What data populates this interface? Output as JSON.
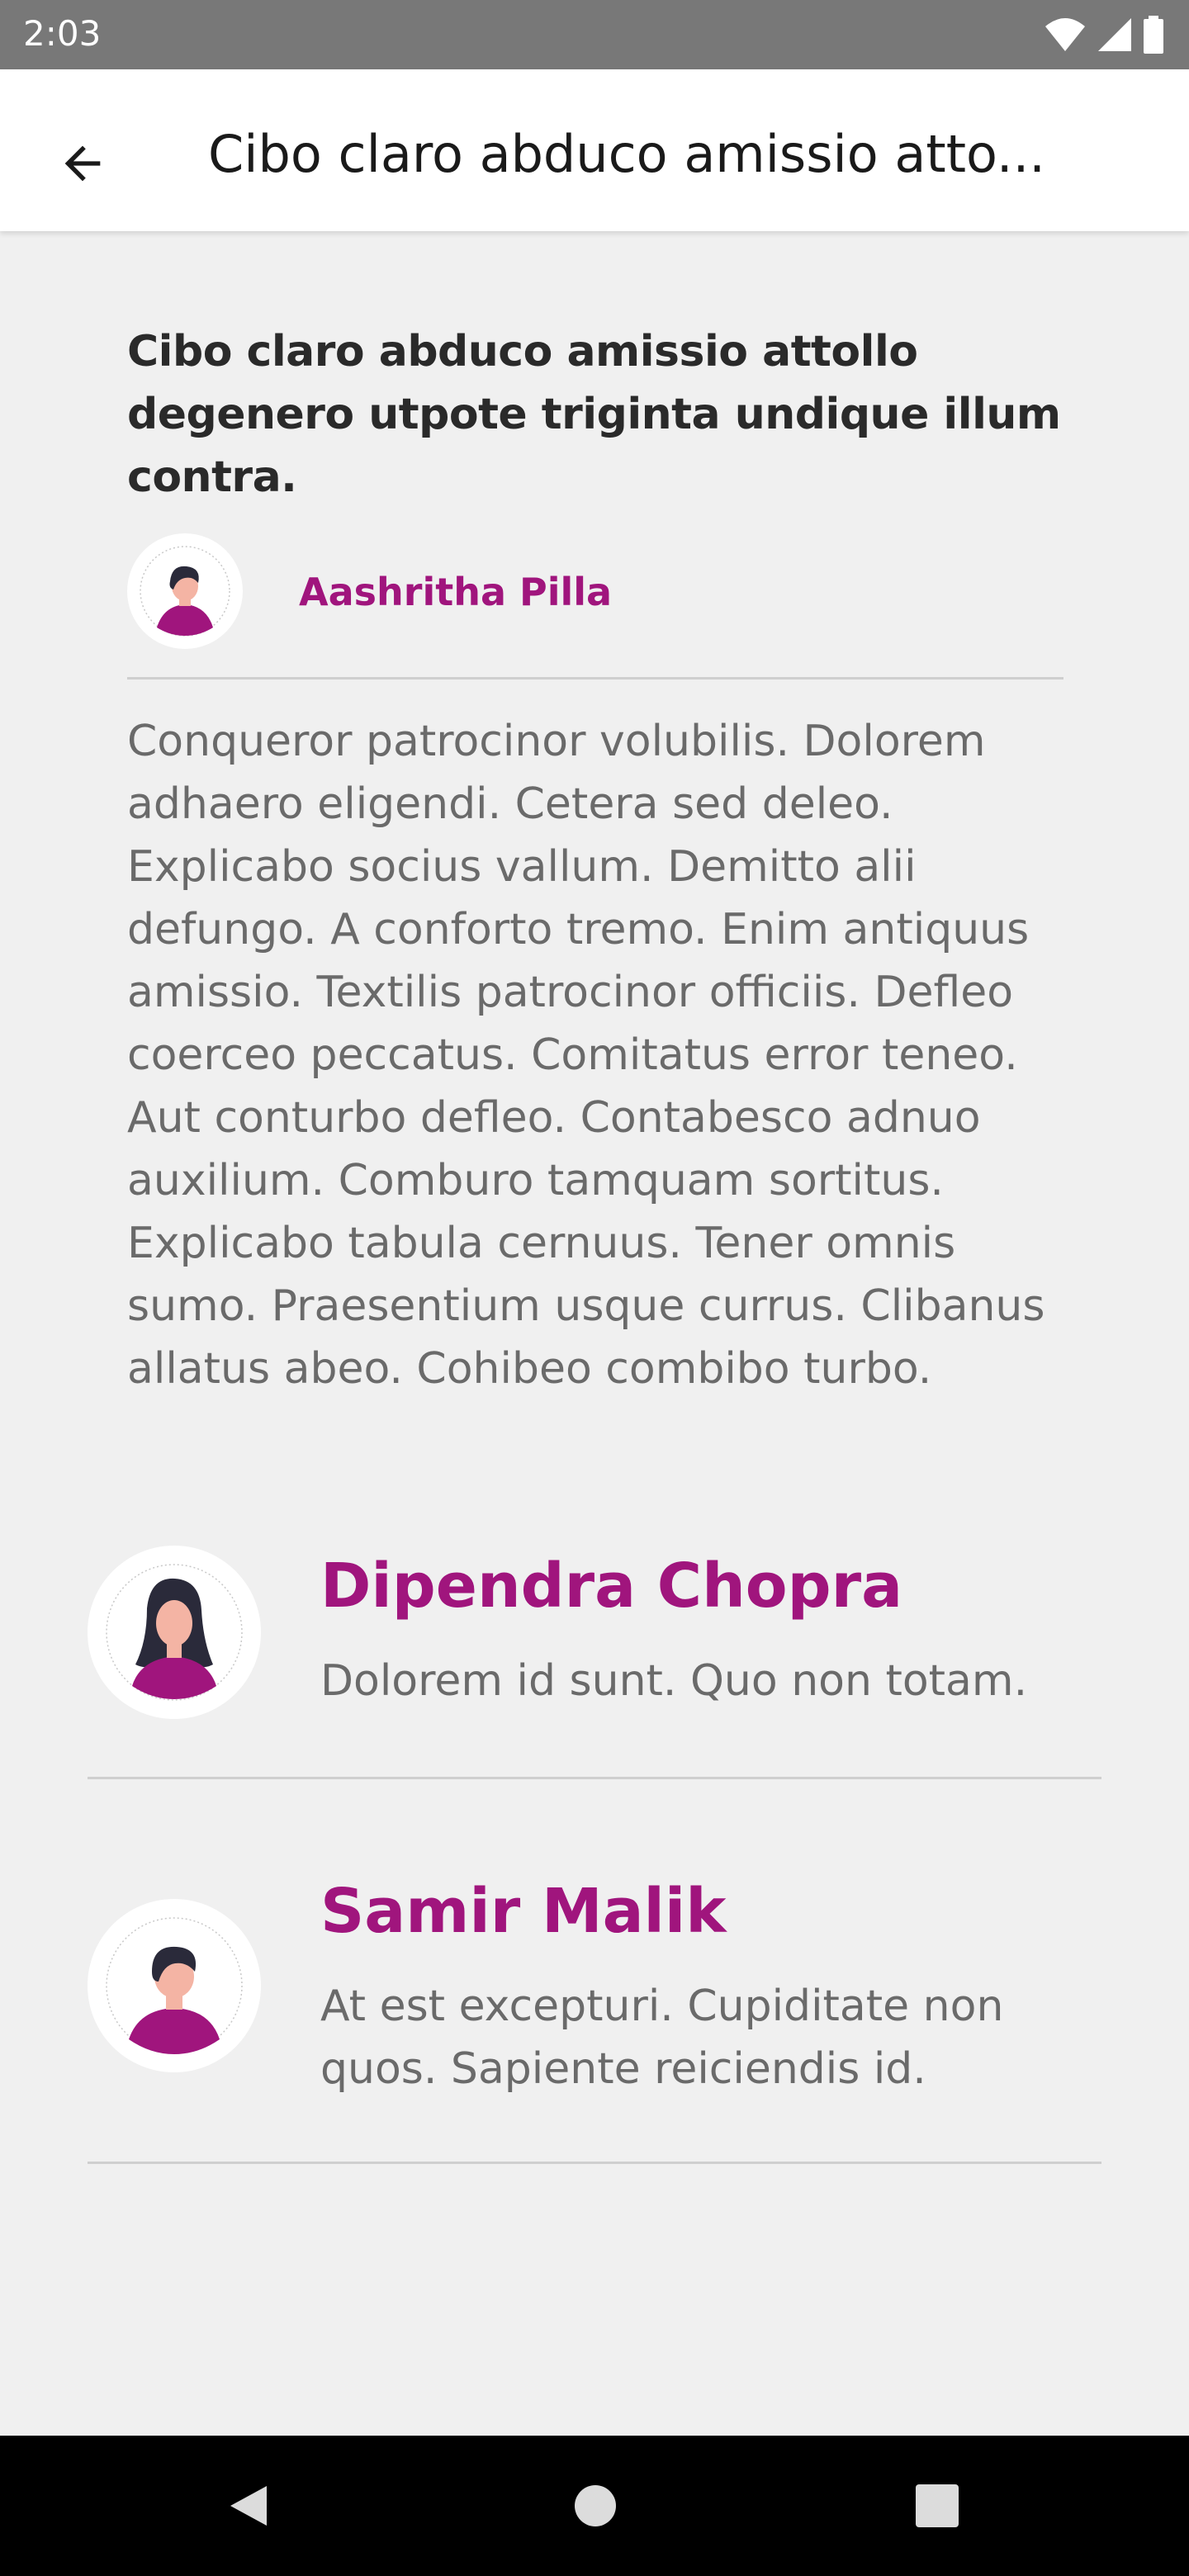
{
  "status_bar": {
    "time": "2:03",
    "icons": [
      "wifi-icon",
      "signal-icon",
      "battery-icon"
    ]
  },
  "app_bar": {
    "title": "Cibo claro abduco amissio atto...",
    "back_icon": "arrow-left-icon"
  },
  "post": {
    "title": "Cibo claro abduco amissio attollo degenero utpote triginta undique illum contra.",
    "author": "Aashritha Pilla",
    "body": "Conqueror patrocinor volubilis. Dolorem adhaero eligendi. Cetera sed deleo. Explicabo socius vallum. Demitto alii defungo. A conforto tremo. Enim antiquus amissio. Textilis patrocinor officiis. Defleo coerceo peccatus. Comitatus error teneo. Aut conturbo defleo. Contabesco adnuo auxilium. Comburo tamquam sortitus. Explicabo tabula cernuus. Tener omnis sumo. Praesentium usque currus. Clibanus allatus abeo. Cohibeo combibo turbo."
  },
  "comments": [
    {
      "name": "Dipendra Chopra",
      "text": "Dolorem id sunt. Quo non totam."
    },
    {
      "name": "Samir Malik",
      "text": "At est excepturi. Cupiditate non quos. Sapiente reiciendis id."
    }
  ],
  "colors": {
    "accent": "#a0157d",
    "background": "#f0f0f0",
    "status_bar": "#787878",
    "nav_bar": "#000000"
  },
  "nav": [
    "back-triangle-icon",
    "home-circle-icon",
    "recents-square-icon"
  ]
}
